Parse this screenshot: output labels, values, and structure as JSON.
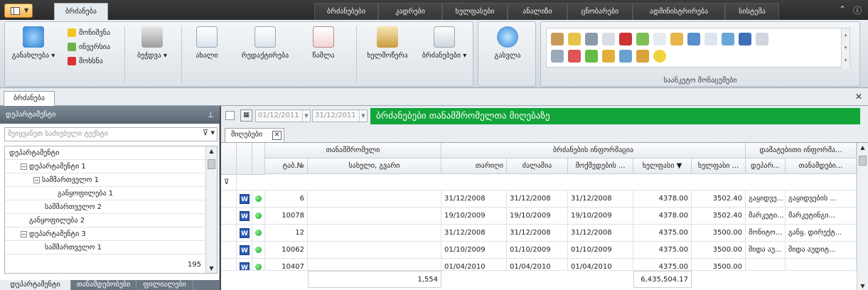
{
  "topbar": {
    "active_tab": "ბრძანება",
    "tabs": [
      "ბრძანებები",
      "კადრები",
      "ხელფასები",
      "ანალიზი",
      "ცნობარები",
      "ადმინისტრირება",
      "სისტემა"
    ],
    "icons": [
      "collapse-ribbon-icon",
      "info-icon"
    ]
  },
  "ribbon": {
    "refresh": "განახლება",
    "mark": "მონიშვნა",
    "invert": "ინვერსია",
    "remove": "მოხსნა",
    "print": "ბეჭდვა",
    "new": "ახალი",
    "edit": "რედაქტირება",
    "delete": "წაშლა",
    "sign": "ხელმოწერა",
    "orders": "ბრძანებები",
    "exit": "გასვლა",
    "gallery_label": "საანკეტო მონაცემები"
  },
  "doc": {
    "tab": "ბრძანება"
  },
  "left": {
    "header": "დეპარტამენტი",
    "search_placeholder": "შეიყვანეთ საძიებელი ტექსტი",
    "tree": [
      {
        "label": "დეპარტამენტი",
        "level": 0,
        "expander": ""
      },
      {
        "label": "დეპარტამენტი 1",
        "level": 1,
        "expander": "−"
      },
      {
        "label": "სამმართველო 1",
        "level": 2,
        "expander": "−"
      },
      {
        "label": "განყოფილება 1",
        "level": 3,
        "expander": ""
      },
      {
        "label": "სამმართველო 2",
        "level": 2,
        "expander": ""
      },
      {
        "label": "განყოფილება 2",
        "level": 1,
        "expander": ""
      },
      {
        "label": "დეპარტამენტი 3",
        "level": 1,
        "expander": "−"
      },
      {
        "label": "სამმართველო 1",
        "level": 2,
        "expander": ""
      }
    ],
    "count": "195",
    "bottom_tabs": [
      "დეპარტამენტი",
      "თანამდებობები",
      "ფილიალები"
    ]
  },
  "main": {
    "date_from": "01/12/2011",
    "date_to": "31/12/2011",
    "banner": "ბრძანებები თანამშრომელთა მიღებაზე",
    "grid_tab": "მიღებები",
    "bands": [
      "თანამშრომელი",
      "ბრძანების ინფორმაცია",
      "დამატებითი ინფორმა..."
    ],
    "columns": [
      "ტაბ.№",
      "სახელი, გვარი",
      "თარიღი",
      "ძალაშია",
      "მოქმედების ...",
      "ხელფასი",
      "ხელფასი ...",
      "დეპარ...",
      "თანამდები..."
    ],
    "rows": [
      {
        "tab": "6",
        "name": "",
        "date": "31/12/2008",
        "valid": "31/12/2008",
        "active": "31/12/2008",
        "salary": "4378.00",
        "salary2": "3502.40",
        "dep": "გაყიდვე...",
        "pos": "გაყიდვების ..."
      },
      {
        "tab": "10078",
        "name": "",
        "date": "19/10/2009",
        "valid": "19/10/2009",
        "active": "19/10/2009",
        "salary": "4378.00",
        "salary2": "3502.40",
        "dep": "მარკეტი...",
        "pos": "მარკეტინგი..."
      },
      {
        "tab": "12",
        "name": "",
        "date": "31/12/2008",
        "valid": "31/12/2008",
        "active": "31/12/2008",
        "salary": "4375.00",
        "salary2": "3500.00",
        "dep": "მონიტო...",
        "pos": "განყ. დირექტ..."
      },
      {
        "tab": "10062",
        "name": "",
        "date": "01/10/2009",
        "valid": "01/10/2009",
        "active": "01/10/2009",
        "salary": "4375.00",
        "salary2": "3500.00",
        "dep": "შიდა აუ...",
        "pos": "შიდა აუდიტ..."
      },
      {
        "tab": "10407",
        "name": "",
        "date": "01/04/2010",
        "valid": "01/04/2010",
        "active": "01/04/2010",
        "salary": "4375.00",
        "salary2": "3500.00",
        "dep": "",
        "pos": ""
      }
    ],
    "footer_count": "1,554",
    "footer_sum": "6,435,504.17"
  }
}
